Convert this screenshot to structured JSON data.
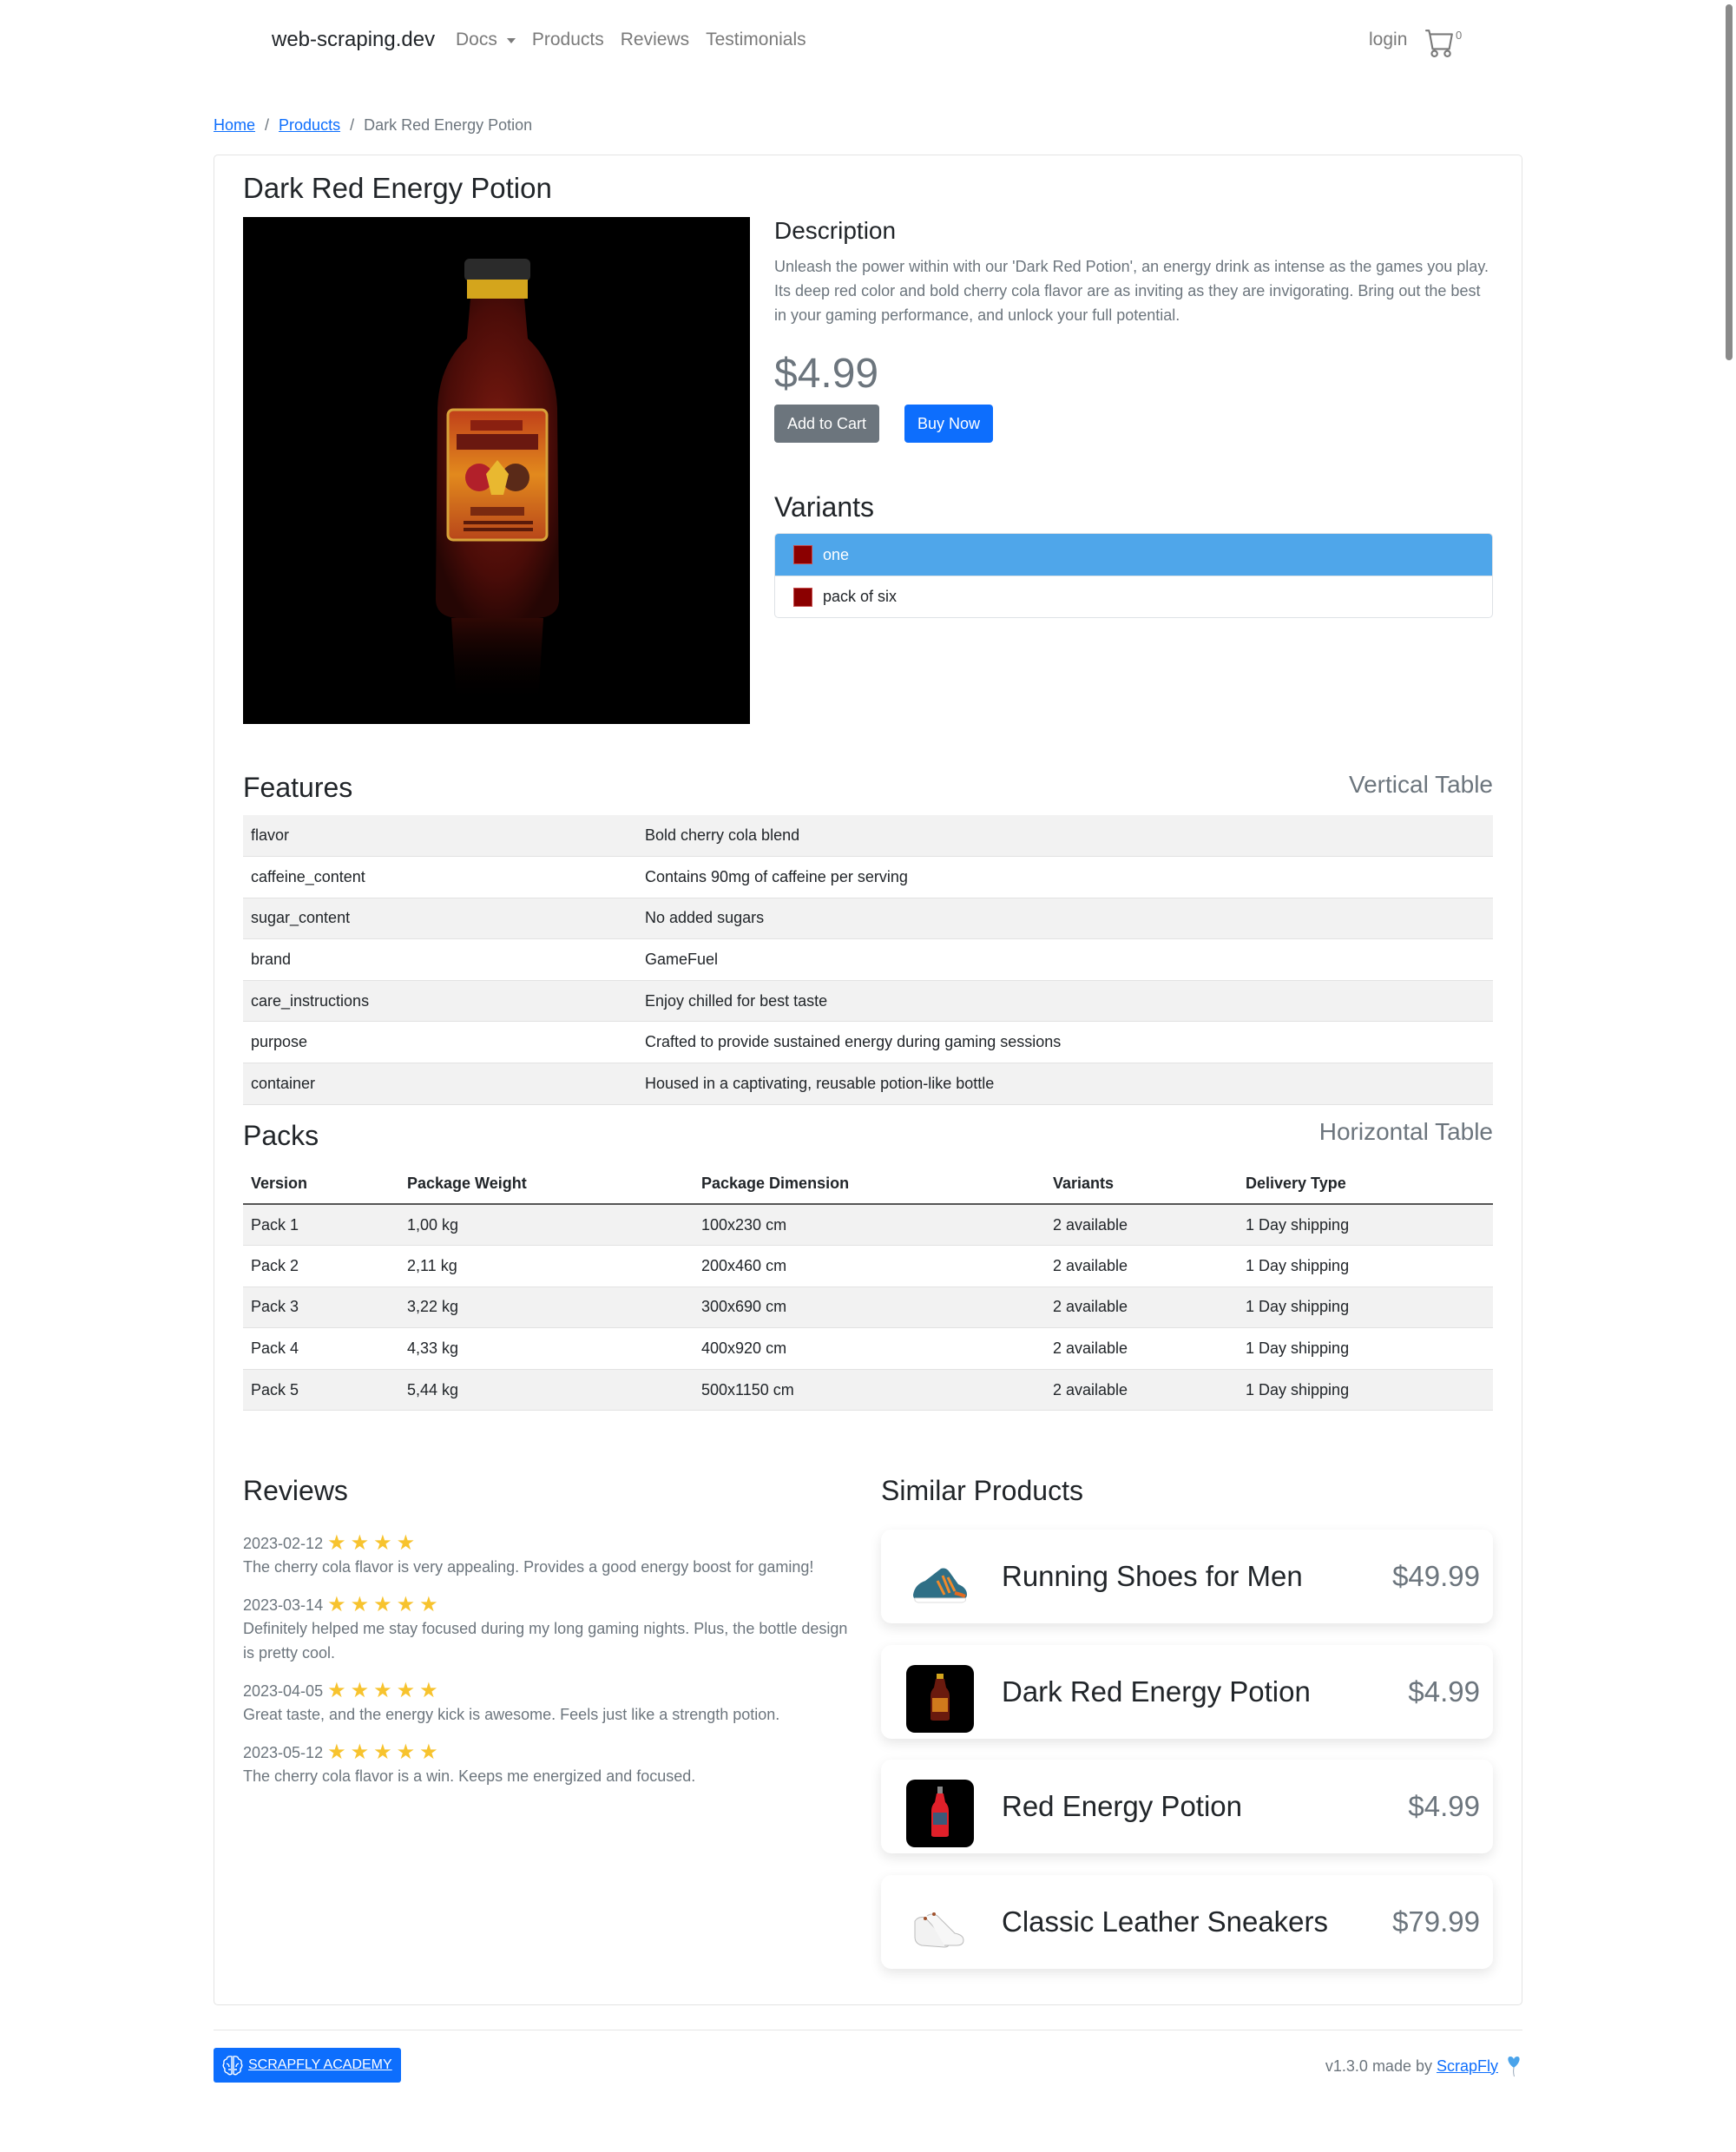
{
  "navbar": {
    "brand": "web-scraping.dev",
    "links": [
      {
        "label": "Docs",
        "dropdown": true
      },
      {
        "label": "Products"
      },
      {
        "label": "Reviews"
      },
      {
        "label": "Testimonials"
      }
    ],
    "login": "login",
    "cart_icon": "shopping-cart-icon",
    "cart_count": "0"
  },
  "breadcrumb": [
    {
      "label": "Home",
      "link": true
    },
    {
      "label": "Products",
      "link": true
    },
    {
      "label": "Dark Red Energy Potion",
      "link": false
    }
  ],
  "breadcrumb_separator": "/",
  "product": {
    "title": "Dark Red Energy Potion",
    "image_alt": "Dark red energy potion bottle on black background",
    "description_heading": "Description",
    "description": "Unleash the power within with our 'Dark Red Potion', an energy drink as intense as the games you play. Its deep red color and bold cherry cola flavor are as inviting as they are invigorating. Bring out the best in your gaming performance, and unlock your full potential.",
    "price": "$4.99",
    "add_to_cart": "Add to Cart",
    "buy_now": "Buy Now",
    "variants_heading": "Variants",
    "variants": [
      {
        "label": "one",
        "color": "#8b0000",
        "active": true
      },
      {
        "label": "pack of six",
        "color": "#8b0000",
        "active": false
      }
    ]
  },
  "features": {
    "heading": "Features",
    "tag": "Vertical Table",
    "rows": [
      {
        "key": "flavor",
        "value": "Bold cherry cola blend"
      },
      {
        "key": "caffeine_content",
        "value": "Contains 90mg of caffeine per serving"
      },
      {
        "key": "sugar_content",
        "value": "No added sugars"
      },
      {
        "key": "brand",
        "value": "GameFuel"
      },
      {
        "key": "care_instructions",
        "value": "Enjoy chilled for best taste"
      },
      {
        "key": "purpose",
        "value": "Crafted to provide sustained energy during gaming sessions"
      },
      {
        "key": "container",
        "value": "Housed in a captivating, reusable potion-like bottle"
      }
    ]
  },
  "packs": {
    "heading": "Packs",
    "tag": "Horizontal Table",
    "columns": [
      "Version",
      "Package Weight",
      "Package Dimension",
      "Variants",
      "Delivery Type"
    ],
    "rows": [
      [
        "Pack 1",
        "1,00 kg",
        "100x230 cm",
        "2 available",
        "1 Day shipping"
      ],
      [
        "Pack 2",
        "2,11 kg",
        "200x460 cm",
        "2 available",
        "1 Day shipping"
      ],
      [
        "Pack 3",
        "3,22 kg",
        "300x690 cm",
        "2 available",
        "1 Day shipping"
      ],
      [
        "Pack 4",
        "4,33 kg",
        "400x920 cm",
        "2 available",
        "1 Day shipping"
      ],
      [
        "Pack 5",
        "5,44 kg",
        "500x1150 cm",
        "2 available",
        "1 Day shipping"
      ]
    ]
  },
  "reviews": {
    "heading": "Reviews",
    "items": [
      {
        "date": "2023-02-12",
        "rating": 4,
        "text": "The cherry cola flavor is very appealing. Provides a good energy boost for gaming!"
      },
      {
        "date": "2023-03-14",
        "rating": 5,
        "text": "Definitely helped me stay focused during my long gaming nights. Plus, the bottle design is pretty cool."
      },
      {
        "date": "2023-04-05",
        "rating": 5,
        "text": "Great taste, and the energy kick is awesome. Feels just like a strength potion."
      },
      {
        "date": "2023-05-12",
        "rating": 5,
        "text": "The cherry cola flavor is a win. Keeps me energized and focused."
      }
    ]
  },
  "similar": {
    "heading": "Similar Products",
    "items": [
      {
        "name": "Running Shoes for Men",
        "price": "$49.99",
        "thumb": "running-shoe"
      },
      {
        "name": "Dark Red Energy Potion",
        "price": "$4.99",
        "thumb": "dark-red-bottle"
      },
      {
        "name": "Red Energy Potion",
        "price": "$4.99",
        "thumb": "red-bottle"
      },
      {
        "name": "Classic Leather Sneakers",
        "price": "$79.99",
        "thumb": "white-sneakers"
      }
    ]
  },
  "footer": {
    "academy_label": "SCRAPFLY ACADEMY",
    "academy_icon": "brain-icon",
    "version_text": "v1.3.0 made by",
    "maker_link": "ScrapFly",
    "heart_icon": "heart-balloon-icon"
  },
  "colors": {
    "primary": "#0d6efd",
    "secondary": "#6c757d",
    "variant_active": "#4fa6ea",
    "star": "#f7c32e"
  }
}
